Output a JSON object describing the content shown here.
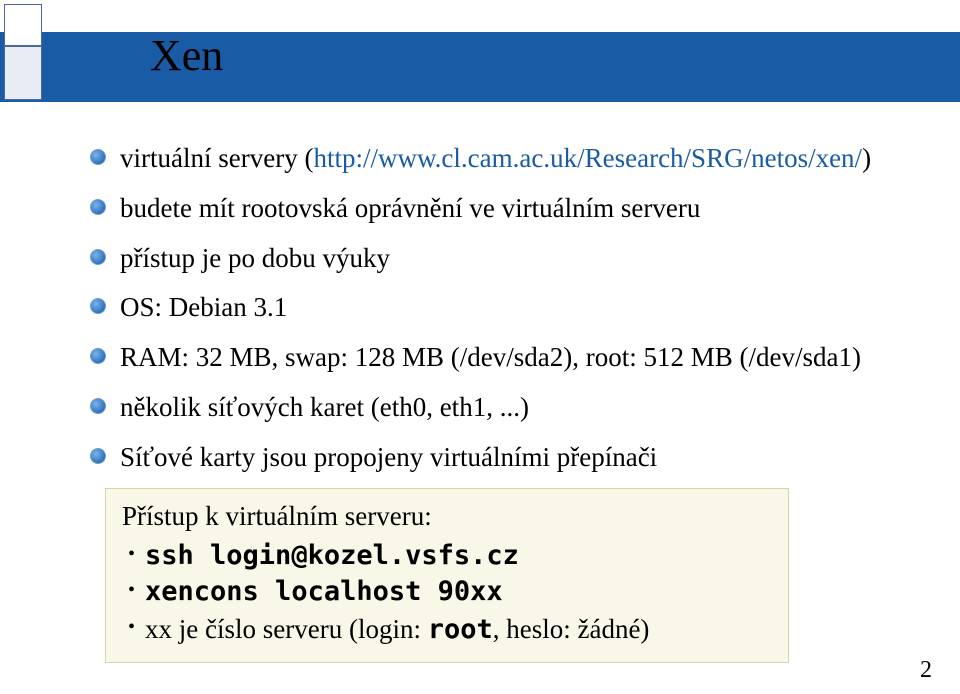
{
  "title": "Xen",
  "bullets": [
    {
      "prefix": "virtuální servery (",
      "link": "http://www.cl.cam.ac.uk/Research/SRG/netos/xen/",
      "suffix": ")"
    },
    {
      "text": "budete mít rootovská oprávnění ve virtuálním serveru"
    },
    {
      "text": "přístup je po dobu výuky"
    },
    {
      "text": "OS: Debian 3.1"
    },
    {
      "text": "RAM: 32 MB, swap: 128 MB (/dev/sda2), root: 512 MB (/dev/sda1)"
    },
    {
      "text": "několik síťových karet (eth0, eth1, ...)"
    },
    {
      "text": "Síťové karty jsou propojeny virtuálními přepínači"
    }
  ],
  "access": {
    "title": "Přístup k virtuálním serveru:",
    "lines": [
      {
        "mono": "ssh login@kozel.vsfs.cz"
      },
      {
        "mono": "xencons localhost 90xx"
      },
      {
        "plain_prefix": "xx je číslo serveru (login: ",
        "mono_mid": "root",
        "plain_suffix": ", heslo: žádné)"
      }
    ]
  },
  "page_number": "2"
}
